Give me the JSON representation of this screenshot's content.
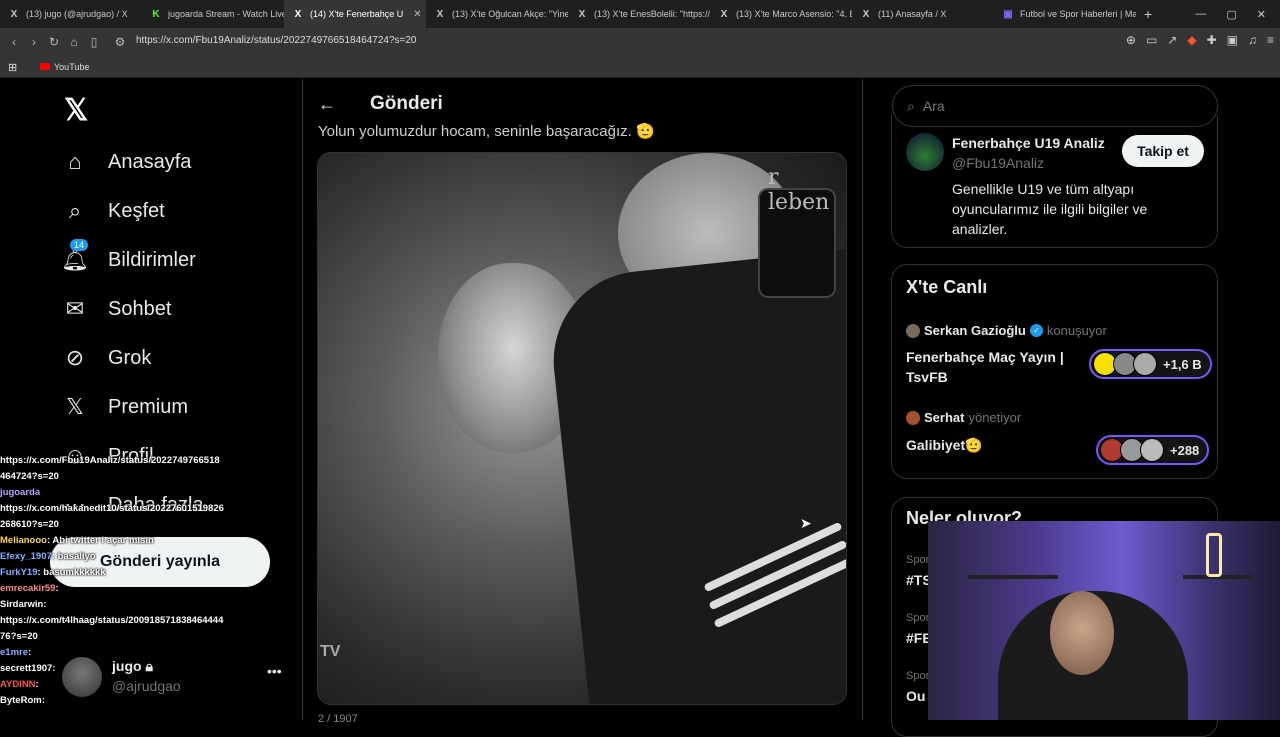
{
  "browser": {
    "tabs": [
      {
        "icon": "X",
        "label": "(13) jugo (@ajrudgao) / X"
      },
      {
        "icon": "K",
        "label": "jugoarda Stream - Watch Live"
      },
      {
        "icon": "X",
        "label": "(14) X'te Fenerbahçe U"
      },
      {
        "icon": "X",
        "label": "(13) X'te Oğulcan Akçe: \"Yine"
      },
      {
        "icon": "X",
        "label": "(13) X'te EnesBolelli: \"https://"
      },
      {
        "icon": "X",
        "label": "(13) X'te Marco Asensio: \"4. Be"
      },
      {
        "icon": "X",
        "label": "(11) Anasayfa / X"
      },
      {
        "icon": "▣",
        "label": "Futbol ve Spor Haberleri | Maç"
      }
    ],
    "url": "https://x.com/Fbu19Analiz/status/2022749766518464724?s=20",
    "bookmark": "YouTube"
  },
  "nav": {
    "items": [
      {
        "label": "Anasayfa",
        "icon": "home-icon"
      },
      {
        "label": "Keşfet",
        "icon": "search-icon"
      },
      {
        "label": "Bildirimler",
        "icon": "bell-icon",
        "badge": "14"
      },
      {
        "label": "Sohbet",
        "icon": "mail-icon"
      },
      {
        "label": "Grok",
        "icon": "grok-icon"
      },
      {
        "label": "Premium",
        "icon": "x-icon"
      },
      {
        "label": "Profil",
        "icon": "person-icon"
      },
      {
        "label": "Daha fazla",
        "icon": "more-icon"
      }
    ],
    "post_button": "Gönderi yayınla",
    "account": {
      "name": "jugo",
      "handle": "@ajrudgao"
    }
  },
  "main": {
    "title": "Gönderi",
    "partial_text": "Yolun yolumuzdur hocam, seninle başaracağız. 🫡",
    "media_watermark": "TV",
    "media_wall_text": "r leben",
    "below_text": "2 / 1907"
  },
  "sidebar": {
    "search_placeholder": "Ara",
    "profile": {
      "name": "Fenerbahçe U19 Analiz",
      "handle": "@Fbu19Analiz",
      "follow": "Takip et",
      "bio": "Genellikle U19 ve tüm altyapı oyuncularımız ile ilgili bilgiler ve analizler."
    },
    "live": {
      "title": "X'te Canlı",
      "spaces": [
        {
          "host": "Serkan Gazioğlu",
          "role": "konuşuyor",
          "topic": "Fenerbahçe Maç Yayın | TsvFB",
          "listeners": "+1,6 B"
        },
        {
          "host": "Serhat",
          "role": "yönetiyor",
          "topic": "Galibiyet🫡",
          "listeners": "+288"
        }
      ]
    },
    "happening": {
      "title": "Neler oluyor?",
      "items": [
        {
          "category": "Spor",
          "tag": "#TS"
        },
        {
          "category": "Spor",
          "tag": "#FB"
        },
        {
          "category": "Spor",
          "tag": "Ou"
        }
      ]
    }
  },
  "chat": [
    {
      "user": "",
      "text": "https://x.com/Fbu19Analiz/status/2022749766518"
    },
    {
      "user": "",
      "text": "464724?s=20"
    },
    {
      "user": "jugoarda",
      "text": ""
    },
    {
      "user": "",
      "text": "https://x.com/hakanedit10/status/20227601519826"
    },
    {
      "user": "",
      "text": "268610?s=20"
    },
    {
      "user": "Melianooo",
      "text": ": Abi twitter i açar mısın"
    },
    {
      "user": "Efexy_1907",
      "text": ": basaliyo"
    },
    {
      "user": "FurkY19",
      "text": ": basumkkkkkk"
    },
    {
      "user": "emrecakir59",
      "text": ":"
    },
    {
      "user": "Sirdarwin",
      "text": ":"
    },
    {
      "user": "",
      "text": "https://x.com/t4lhaag/status/200918571838464444"
    },
    {
      "user": "",
      "text": "76?s=20"
    },
    {
      "user": "e1mre",
      "text": ":"
    },
    {
      "user": "secrett1907",
      "text": ":"
    },
    {
      "user": "AYDINN",
      "text": ":"
    },
    {
      "user": "ByteRom",
      "text": ":"
    }
  ]
}
